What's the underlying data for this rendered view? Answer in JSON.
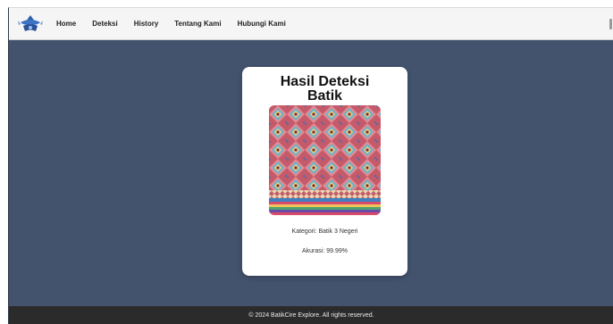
{
  "navbar": {
    "logo_icon": "batik-logo-icon",
    "items": [
      {
        "label": "Home"
      },
      {
        "label": "Deteksi"
      },
      {
        "label": "History"
      },
      {
        "label": "Tentang Kami"
      },
      {
        "label": "Hubungi Kami"
      }
    ]
  },
  "result": {
    "title_line1": "Hasil Deteksi",
    "title_line2": "Batik",
    "image_icon": "batik-image",
    "category": "Kategori: Batik 3 Negeri",
    "accuracy": "Akurasi: 99.99%"
  },
  "footer": {
    "text": "© 2024 BatikCire Explore. All rights reserved."
  },
  "colors": {
    "background": "#43536e",
    "navbar": "#f5f5f5",
    "card": "#ffffff",
    "footer": "#2b2b2b"
  }
}
